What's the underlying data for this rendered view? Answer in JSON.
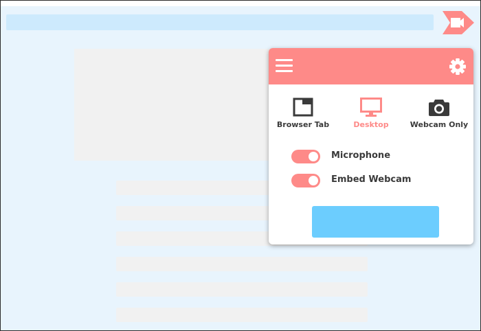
{
  "browser": {
    "extension_icon": "screen-recorder-extension-icon"
  },
  "popup": {
    "header": {
      "menu_icon": "hamburger-menu-icon",
      "settings_icon": "gear-icon"
    },
    "modes": [
      {
        "label": "Browser Tab",
        "icon": "browser-tab-icon",
        "active": false
      },
      {
        "label": "Desktop",
        "icon": "monitor-icon",
        "active": true
      },
      {
        "label": "Webcam Only",
        "icon": "camera-icon",
        "active": false
      }
    ],
    "toggles": [
      {
        "label": "Microphone",
        "on": true
      },
      {
        "label": "Embed Webcam",
        "on": true
      }
    ],
    "start_button_label": ""
  },
  "colors": {
    "page_background": "#e8f4fd",
    "address_bar": "#cdeafd",
    "accent": "#fe8a88",
    "start_button": "#6ccdfe",
    "placeholder": "#f1f1f1",
    "text": "#3a3a3a"
  }
}
